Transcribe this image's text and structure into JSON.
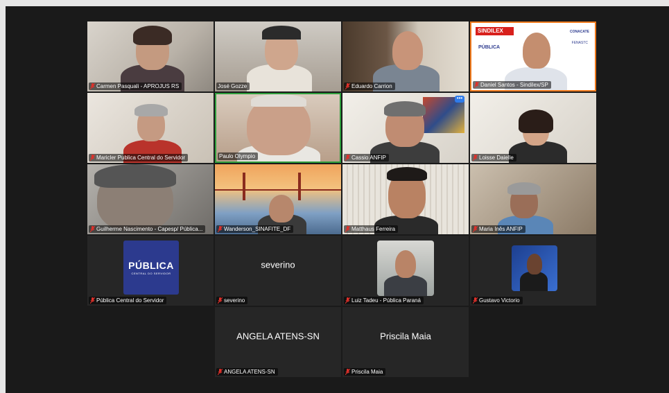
{
  "participants": [
    {
      "name": "Carmen Pasquali - APROJUS RS"
    },
    {
      "name": "José Gozze"
    },
    {
      "name": "Eduardo Carrion"
    },
    {
      "name": "Daniel Santos - Sindilex/SP"
    },
    {
      "name": "Maricler Publica Central do Servidor"
    },
    {
      "name": "Paulo Olympio"
    },
    {
      "name": "Cassio ANFIP"
    },
    {
      "name": "Loisse Daielle"
    },
    {
      "name": "Guilherme Nascimento - Capesp/ Pública..."
    },
    {
      "name": "Wanderson_SINAFITE_DF"
    },
    {
      "name": "Matthaus Ferreira"
    },
    {
      "name": "Maria Inês ANFIP"
    },
    {
      "name": "Pública Central do Servidor",
      "logo_text": "PÚBLICA",
      "logo_sub": "CENTRAL DO SERVIDOR"
    },
    {
      "name": "severino",
      "center_text": "severino"
    },
    {
      "name": "Luiz Tadeu - Pública Paraná"
    },
    {
      "name": "Gustavo Victorio"
    },
    {
      "name": "ANGELA ATENS-SN",
      "center_text": "ANGELA ATENS-SN"
    },
    {
      "name": "Priscila Maia",
      "center_text": "Priscila Maia"
    }
  ],
  "sindilex_banner": {
    "brand": "SINDILEX",
    "logo1": "CONACATE",
    "logo2": "FENASTC",
    "logo3": "PÚBLICA"
  },
  "colors": {
    "active_speaker": "#2e9e3c",
    "muted_mic": "#e0302a",
    "stage": "#1a1a1a"
  }
}
